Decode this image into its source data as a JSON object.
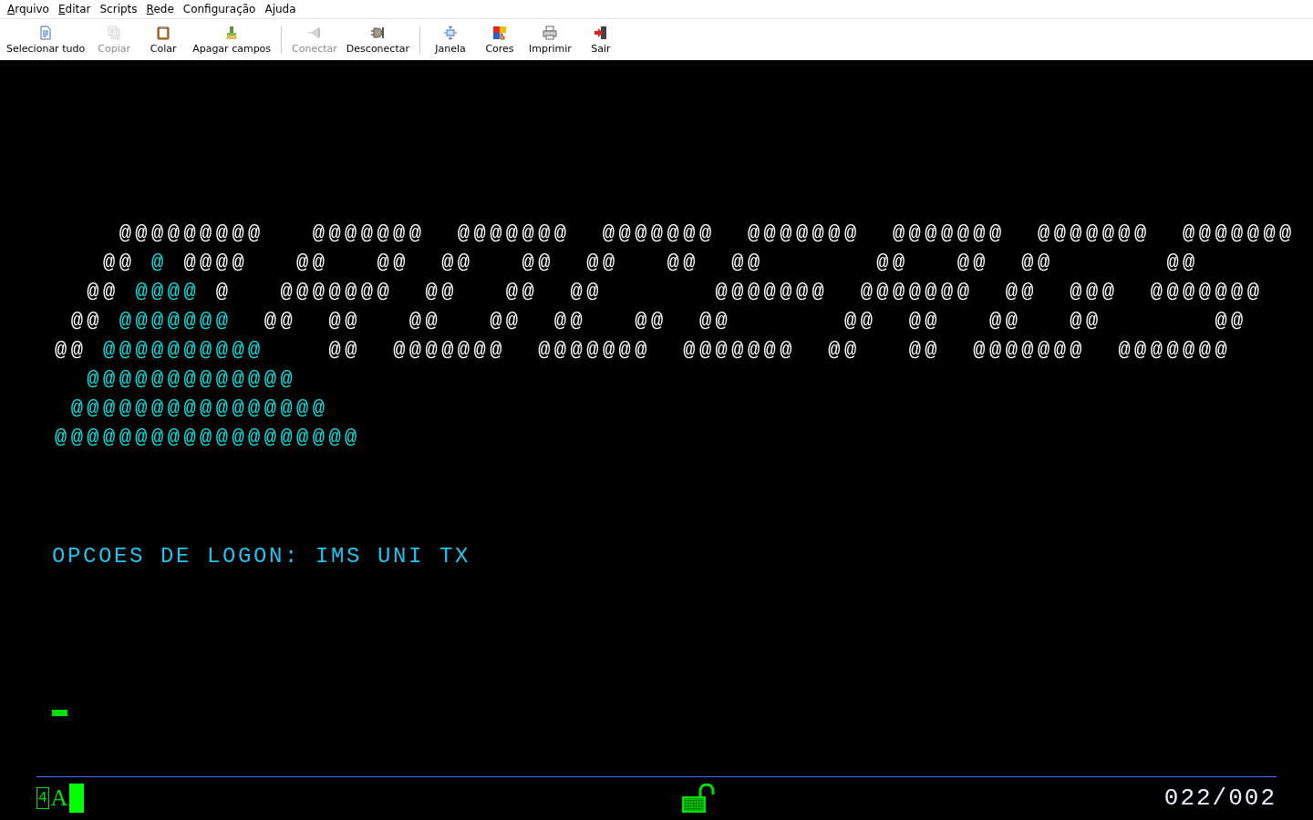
{
  "menu": [
    {
      "label": "Arquivo",
      "mnemonic": true
    },
    {
      "label": "Editar",
      "mnemonic": true
    },
    {
      "label": "Scripts",
      "mnemonic": false
    },
    {
      "label": "Rede",
      "mnemonic": true
    },
    {
      "label": "Configuração",
      "mnemonic": false
    },
    {
      "label": "Ajuda",
      "mnemonic": false
    }
  ],
  "toolbar": [
    {
      "items": [
        {
          "label": "Selecionar tudo",
          "kind": "select",
          "disabled": false
        },
        {
          "label": "Copiar",
          "kind": "copy",
          "disabled": true
        },
        {
          "label": "Colar",
          "kind": "paste",
          "disabled": false
        },
        {
          "label": "Apagar campos",
          "kind": "erase",
          "disabled": false
        }
      ]
    },
    {
      "items": [
        {
          "label": "Conectar",
          "kind": "connect",
          "disabled": true
        },
        {
          "label": "Desconectar",
          "kind": "disconnect",
          "disabled": false
        }
      ]
    },
    {
      "items": [
        {
          "label": "Janela",
          "kind": "window",
          "disabled": false
        },
        {
          "label": "Cores",
          "kind": "colors",
          "disabled": false
        },
        {
          "label": "Imprimir",
          "kind": "print",
          "disabled": false
        },
        {
          "label": "Sair",
          "kind": "exit",
          "disabled": false
        }
      ]
    }
  ],
  "screen": {
    "banner": [
      [
        {
          "text": "    @@@@@@@@@   @@@@@@@  @@@@@@@  @@@@@@@  @@@@@@@  @@@@@@@  @@@@@@@  @@@@@@@",
          "color": "#ffffff"
        }
      ],
      [
        {
          "text": "   @@ ",
          "color": "#ffffff"
        },
        {
          "text": "@",
          "color": "#00e5e5"
        },
        {
          "text": " @@@@   @@   @@  @@   @@  @@   @@  @@       @@   @@  @@       @@",
          "color": "#ffffff"
        }
      ],
      [
        {
          "text": "  @@ ",
          "color": "#ffffff"
        },
        {
          "text": "@@@@",
          "color": "#00e5e5"
        },
        {
          "text": " @   @@@@@@@  @@   @@  @@       @@@@@@@  @@@@@@@  @@  @@@  @@@@@@@",
          "color": "#ffffff"
        }
      ],
      [
        {
          "text": " @@ ",
          "color": "#ffffff"
        },
        {
          "text": "@@@@@@@",
          "color": "#00e5e5"
        },
        {
          "text": "  @@  @@   @@   @@  @@   @@  @@       @@  @@   @@   @@       @@",
          "color": "#ffffff"
        }
      ],
      [
        {
          "text": "@@ ",
          "color": "#ffffff"
        },
        {
          "text": "@@@@@@@@@@",
          "color": "#00e5e5"
        },
        {
          "text": "    @@  @@@@@@@  @@@@@@@  @@@@@@@  @@   @@  @@@@@@@  @@@@@@@",
          "color": "#ffffff"
        }
      ],
      [
        {
          "text": "  @@@@@@@@@@@@@",
          "color": "#00e5e5"
        }
      ],
      [
        {
          "text": " @@@@@@@@@@@@@@@@",
          "color": "#00e5e5"
        }
      ],
      [
        {
          "text": "@@@@@@@@@@@@@@@@@@@",
          "color": "#00e5e5"
        }
      ]
    ],
    "logon_options": "OPCOES DE LOGON: IMS UNI TX"
  },
  "status_bar": {
    "session": "4",
    "indicator": "A",
    "keyboard_locked": false,
    "cursor_position": "022/002"
  }
}
